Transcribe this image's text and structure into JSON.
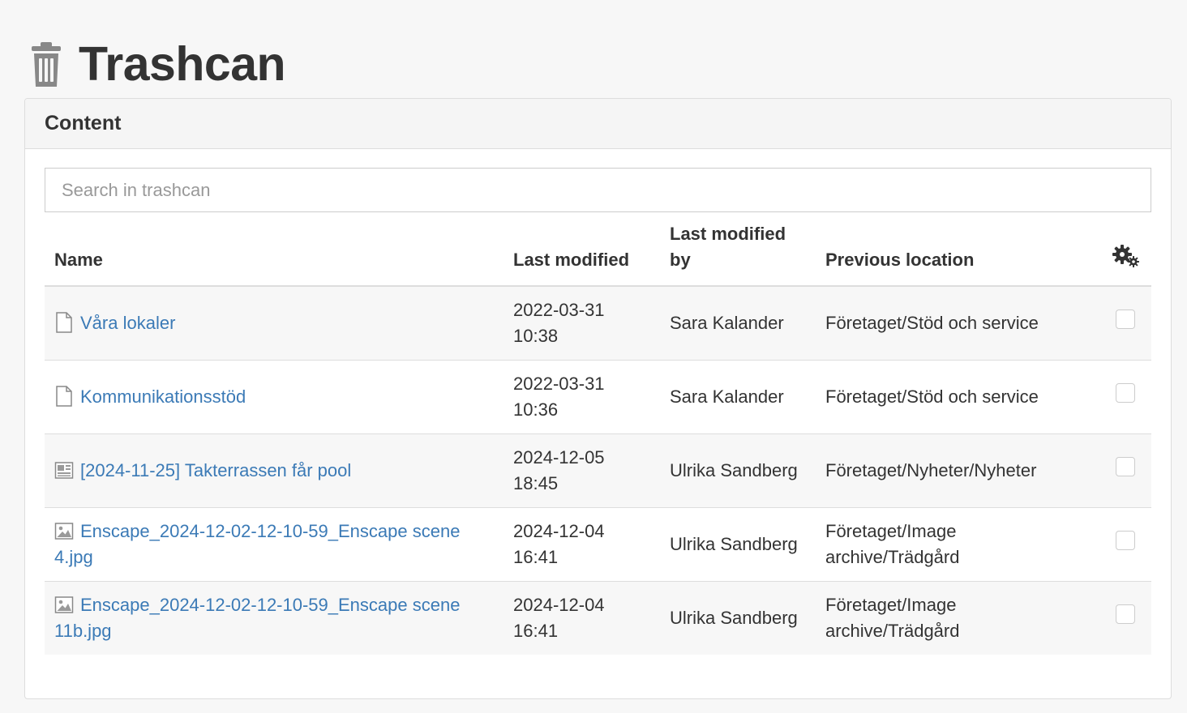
{
  "page": {
    "title": "Trashcan",
    "icon": "trash-icon"
  },
  "panel": {
    "title": "Content"
  },
  "search": {
    "placeholder": "Search in trashcan",
    "value": ""
  },
  "table": {
    "headers": {
      "name": "Name",
      "last_modified": "Last modified",
      "last_modified_by": "Last modified by",
      "previous_location": "Previous location",
      "settings_icon": "gears-icon"
    },
    "rows": [
      {
        "icon": "page-icon",
        "name": "Våra lokaler",
        "modified_date": "2022-03-31",
        "modified_time": "10:38",
        "modified_by": "Sara Kalander",
        "location": "Företaget/Stöd och service",
        "selected": false
      },
      {
        "icon": "page-icon",
        "name": "Kommunikationsstöd",
        "modified_date": "2022-03-31",
        "modified_time": "10:36",
        "modified_by": "Sara Kalander",
        "location": "Företaget/Stöd och service",
        "selected": false
      },
      {
        "icon": "news-icon",
        "name": "[2024-11-25] Takterrassen får pool",
        "modified_date": "2024-12-05",
        "modified_time": "18:45",
        "modified_by": "Ulrika Sandberg",
        "location": "Företaget/Nyheter/Nyheter",
        "selected": false
      },
      {
        "icon": "image-icon",
        "name": "Enscape_2024-12-02-12-10-59_Enscape scene 4.jpg",
        "modified_date": "2024-12-04",
        "modified_time": "16:41",
        "modified_by": "Ulrika Sandberg",
        "location": "Företaget/Image archive/Trädgård",
        "selected": false
      },
      {
        "icon": "image-icon",
        "name": "Enscape_2024-12-02-12-10-59_Enscape scene 11b.jpg",
        "modified_date": "2024-12-04",
        "modified_time": "16:41",
        "modified_by": "Ulrika Sandberg",
        "location": "Företaget/Image archive/Trädgård",
        "selected": false
      }
    ]
  },
  "colors": {
    "link": "#3b7ab6",
    "text": "#333333",
    "stripe": "#f7f7f7",
    "border": "#dddddd"
  }
}
